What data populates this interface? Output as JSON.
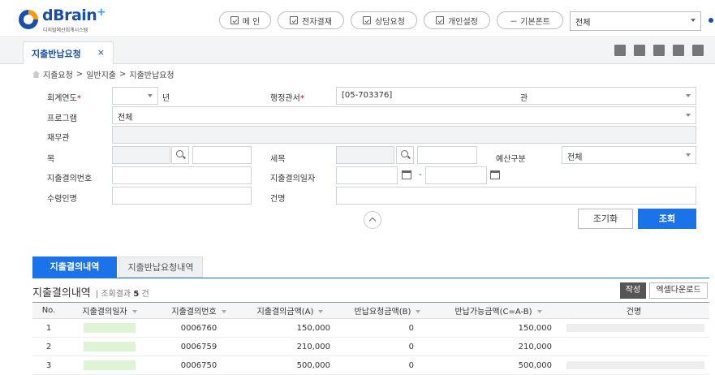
{
  "app": {
    "logo_name": "dBrain",
    "logo_plus": "+",
    "logo_sub": "디지털예산회계시스템"
  },
  "nav": {
    "buttons": [
      "메 인",
      "전자결재",
      "상담요청",
      "개인설정"
    ],
    "font_button": "－ 기본폰트",
    "select_value": "전체"
  },
  "tabbar": {
    "tab_label": "지출반납요청",
    "close": "×"
  },
  "breadcrumb": [
    "지출요청",
    ">",
    "일반지출",
    ">",
    "지출반납요청"
  ],
  "form": {
    "year_label": "회계연도",
    "year_value": "",
    "year_suffix": "년",
    "office_label": "행정관서",
    "office_value": "[05-703376]",
    "office_suffix": "관",
    "program_label": "프로그램",
    "program_value": "전체",
    "finance_label": "재무관",
    "mok_label": "목",
    "semok_label": "세목",
    "budget_label": "예산구분",
    "budget_value": "전체",
    "resolution_no_label": "지출결의번호",
    "resolution_date_label": "지출결의일자",
    "date_sep": "-",
    "payee_label": "수령인명",
    "subject_label": "건명",
    "required_mark": "*"
  },
  "actions": {
    "reset": "조기화",
    "search": "조회"
  },
  "result_tabs": [
    "지출결의내역",
    "지출반납요청내역"
  ],
  "list": {
    "title": "지출결의내역",
    "count_label": "조회결과",
    "count": "5",
    "count_unit": "건",
    "write_btn": "작성",
    "excel_btn": "엑셀다운로드",
    "columns": [
      "No.",
      "지출결의일자",
      "지출결의번호",
      "지출결의금액(A)",
      "반납요청금액(B)",
      "반납가능금액(C=A-B)",
      "건명"
    ],
    "rows": [
      {
        "no": "1",
        "number": "0006760",
        "amount": "150,000",
        "requested": "0",
        "available": "150,000"
      },
      {
        "no": "2",
        "number": "0006759",
        "amount": "210,000",
        "requested": "0",
        "available": "210,000"
      },
      {
        "no": "3",
        "number": "0006750",
        "amount": "500,000",
        "requested": "0",
        "available": "500,000"
      }
    ]
  },
  "colors": {
    "brand": "#1b4fa3",
    "accent": "#1a73e8",
    "required": "#d0021b"
  }
}
